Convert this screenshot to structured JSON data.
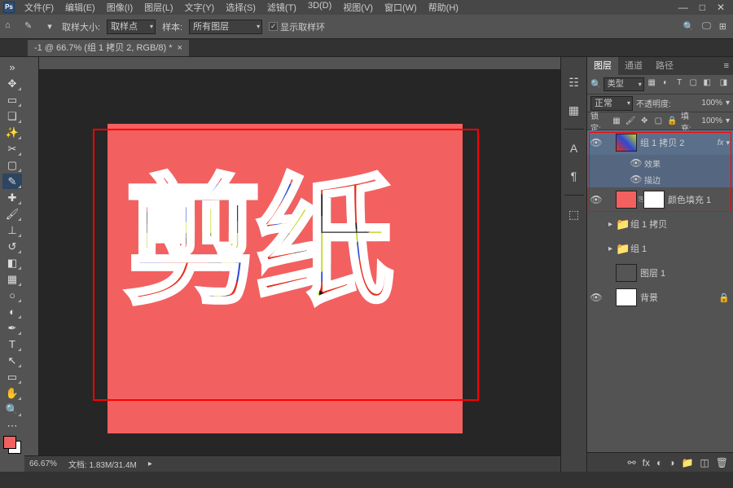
{
  "menu": {
    "file": "文件(F)",
    "edit": "编辑(E)",
    "image": "图像(I)",
    "layer": "图层(L)",
    "type": "文字(Y)",
    "select": "选择(S)",
    "filter": "滤镜(T)",
    "threeD": "3D(D)",
    "view": "视图(V)",
    "window": "窗口(W)",
    "help": "帮助(H)"
  },
  "winctl": {
    "min": "—",
    "max": "□",
    "close": "✕"
  },
  "options": {
    "sampleSizeLabel": "取样大小:",
    "sampleSize": "取样点",
    "sampleLabel": "样本:",
    "sample": "所有图层",
    "showRingLabel": "显示取样环"
  },
  "doctab": {
    "name": "-1 @ 66.7% (组 1 拷贝 2, RGB/8) *"
  },
  "canvasText": "剪纸",
  "statusbar": {
    "zoom": "66.67%",
    "doc": "文档: 1.83M/31.4M"
  },
  "panels": {
    "tabs": {
      "layers": "图层",
      "channels": "通道",
      "paths": "路径"
    },
    "filter": {
      "kind": "类型"
    },
    "blend": {
      "mode": "正常",
      "opacityLabel": "不透明度:",
      "opacity": "100%"
    },
    "lock": {
      "label": "锁定:",
      "fillLabel": "填充:",
      "fill": "100%"
    }
  },
  "layers": {
    "l1": "组 1 拷贝 2",
    "fx": "fx",
    "eff1": "效果",
    "eff2": "描边",
    "l2": "颜色填充 1",
    "l3": "组 1 拷贝",
    "l4": "组 1",
    "l5": "图层 1",
    "l6": "背景"
  }
}
